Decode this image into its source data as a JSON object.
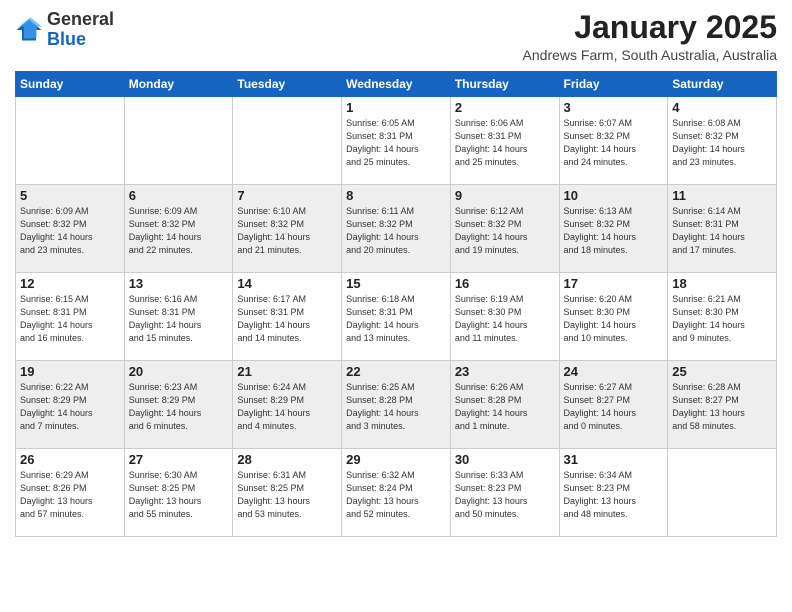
{
  "logo": {
    "general": "General",
    "blue": "Blue"
  },
  "header": {
    "month": "January 2025",
    "location": "Andrews Farm, South Australia, Australia"
  },
  "weekdays": [
    "Sunday",
    "Monday",
    "Tuesday",
    "Wednesday",
    "Thursday",
    "Friday",
    "Saturday"
  ],
  "weeks": [
    {
      "stripe": 0,
      "days": [
        {
          "num": "",
          "info": ""
        },
        {
          "num": "",
          "info": ""
        },
        {
          "num": "",
          "info": ""
        },
        {
          "num": "1",
          "info": "Sunrise: 6:05 AM\nSunset: 8:31 PM\nDaylight: 14 hours\nand 25 minutes."
        },
        {
          "num": "2",
          "info": "Sunrise: 6:06 AM\nSunset: 8:31 PM\nDaylight: 14 hours\nand 25 minutes."
        },
        {
          "num": "3",
          "info": "Sunrise: 6:07 AM\nSunset: 8:32 PM\nDaylight: 14 hours\nand 24 minutes."
        },
        {
          "num": "4",
          "info": "Sunrise: 6:08 AM\nSunset: 8:32 PM\nDaylight: 14 hours\nand 23 minutes."
        }
      ]
    },
    {
      "stripe": 1,
      "days": [
        {
          "num": "5",
          "info": "Sunrise: 6:09 AM\nSunset: 8:32 PM\nDaylight: 14 hours\nand 23 minutes."
        },
        {
          "num": "6",
          "info": "Sunrise: 6:09 AM\nSunset: 8:32 PM\nDaylight: 14 hours\nand 22 minutes."
        },
        {
          "num": "7",
          "info": "Sunrise: 6:10 AM\nSunset: 8:32 PM\nDaylight: 14 hours\nand 21 minutes."
        },
        {
          "num": "8",
          "info": "Sunrise: 6:11 AM\nSunset: 8:32 PM\nDaylight: 14 hours\nand 20 minutes."
        },
        {
          "num": "9",
          "info": "Sunrise: 6:12 AM\nSunset: 8:32 PM\nDaylight: 14 hours\nand 19 minutes."
        },
        {
          "num": "10",
          "info": "Sunrise: 6:13 AM\nSunset: 8:32 PM\nDaylight: 14 hours\nand 18 minutes."
        },
        {
          "num": "11",
          "info": "Sunrise: 6:14 AM\nSunset: 8:31 PM\nDaylight: 14 hours\nand 17 minutes."
        }
      ]
    },
    {
      "stripe": 0,
      "days": [
        {
          "num": "12",
          "info": "Sunrise: 6:15 AM\nSunset: 8:31 PM\nDaylight: 14 hours\nand 16 minutes."
        },
        {
          "num": "13",
          "info": "Sunrise: 6:16 AM\nSunset: 8:31 PM\nDaylight: 14 hours\nand 15 minutes."
        },
        {
          "num": "14",
          "info": "Sunrise: 6:17 AM\nSunset: 8:31 PM\nDaylight: 14 hours\nand 14 minutes."
        },
        {
          "num": "15",
          "info": "Sunrise: 6:18 AM\nSunset: 8:31 PM\nDaylight: 14 hours\nand 13 minutes."
        },
        {
          "num": "16",
          "info": "Sunrise: 6:19 AM\nSunset: 8:30 PM\nDaylight: 14 hours\nand 11 minutes."
        },
        {
          "num": "17",
          "info": "Sunrise: 6:20 AM\nSunset: 8:30 PM\nDaylight: 14 hours\nand 10 minutes."
        },
        {
          "num": "18",
          "info": "Sunrise: 6:21 AM\nSunset: 8:30 PM\nDaylight: 14 hours\nand 9 minutes."
        }
      ]
    },
    {
      "stripe": 1,
      "days": [
        {
          "num": "19",
          "info": "Sunrise: 6:22 AM\nSunset: 8:29 PM\nDaylight: 14 hours\nand 7 minutes."
        },
        {
          "num": "20",
          "info": "Sunrise: 6:23 AM\nSunset: 8:29 PM\nDaylight: 14 hours\nand 6 minutes."
        },
        {
          "num": "21",
          "info": "Sunrise: 6:24 AM\nSunset: 8:29 PM\nDaylight: 14 hours\nand 4 minutes."
        },
        {
          "num": "22",
          "info": "Sunrise: 6:25 AM\nSunset: 8:28 PM\nDaylight: 14 hours\nand 3 minutes."
        },
        {
          "num": "23",
          "info": "Sunrise: 6:26 AM\nSunset: 8:28 PM\nDaylight: 14 hours\nand 1 minute."
        },
        {
          "num": "24",
          "info": "Sunrise: 6:27 AM\nSunset: 8:27 PM\nDaylight: 14 hours\nand 0 minutes."
        },
        {
          "num": "25",
          "info": "Sunrise: 6:28 AM\nSunset: 8:27 PM\nDaylight: 13 hours\nand 58 minutes."
        }
      ]
    },
    {
      "stripe": 0,
      "days": [
        {
          "num": "26",
          "info": "Sunrise: 6:29 AM\nSunset: 8:26 PM\nDaylight: 13 hours\nand 57 minutes."
        },
        {
          "num": "27",
          "info": "Sunrise: 6:30 AM\nSunset: 8:25 PM\nDaylight: 13 hours\nand 55 minutes."
        },
        {
          "num": "28",
          "info": "Sunrise: 6:31 AM\nSunset: 8:25 PM\nDaylight: 13 hours\nand 53 minutes."
        },
        {
          "num": "29",
          "info": "Sunrise: 6:32 AM\nSunset: 8:24 PM\nDaylight: 13 hours\nand 52 minutes."
        },
        {
          "num": "30",
          "info": "Sunrise: 6:33 AM\nSunset: 8:23 PM\nDaylight: 13 hours\nand 50 minutes."
        },
        {
          "num": "31",
          "info": "Sunrise: 6:34 AM\nSunset: 8:23 PM\nDaylight: 13 hours\nand 48 minutes."
        },
        {
          "num": "",
          "info": ""
        }
      ]
    }
  ]
}
